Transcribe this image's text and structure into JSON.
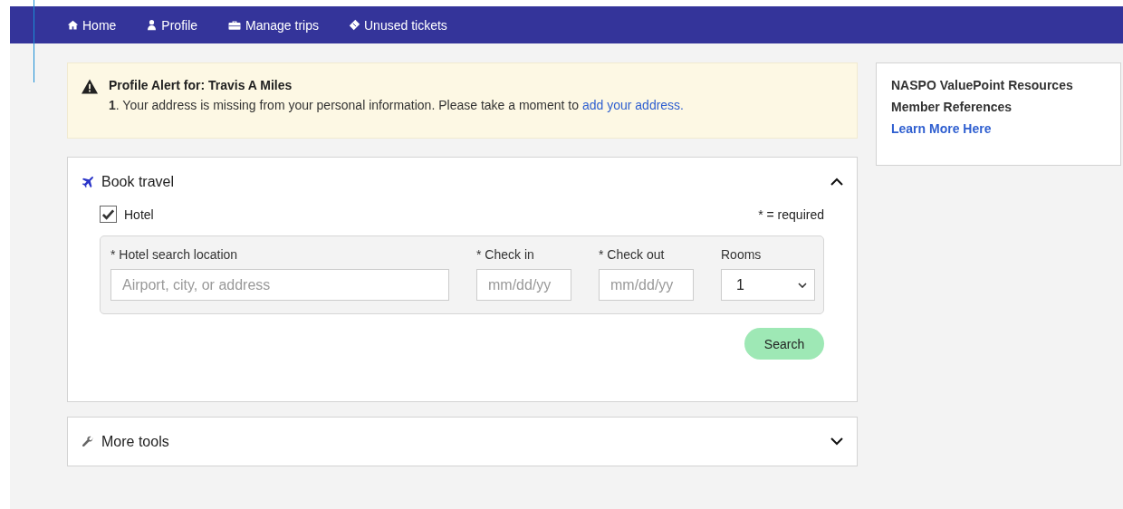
{
  "nav": [
    {
      "label": "Home"
    },
    {
      "label": "Profile"
    },
    {
      "label": "Manage trips"
    },
    {
      "label": "Unused tickets"
    }
  ],
  "alert": {
    "title": "Profile Alert for:  Travis A Miles",
    "message": "**1**. Your address is missing from your personal information. Please take a moment to",
    "link": "add your address."
  },
  "panels": [
    {
      "kind": "book",
      "title": "Book travel",
      "expanded": true
    },
    {
      "kind": "tools",
      "title": "More tools",
      "expanded": false
    }
  ],
  "booking": {
    "hotel": {
      "label": "Hotel",
      "checked": true
    },
    "required_note": "* = required",
    "fields": [
      {
        "kind": "text",
        "label": "* Hotel search location",
        "placeholder": "Airport, city, or address"
      },
      {
        "kind": "date",
        "label": "* Check in",
        "placeholder": "mm/dd/yy"
      },
      {
        "kind": "date",
        "label": "* Check out",
        "placeholder": "mm/dd/yy"
      },
      {
        "kind": "select",
        "label": "Rooms",
        "value": "1"
      }
    ],
    "search_button": "Search"
  },
  "sidebar": {
    "title": "NASPO ValuePoint Resources",
    "subtitle": "Member References",
    "link": "Learn More Here"
  }
}
